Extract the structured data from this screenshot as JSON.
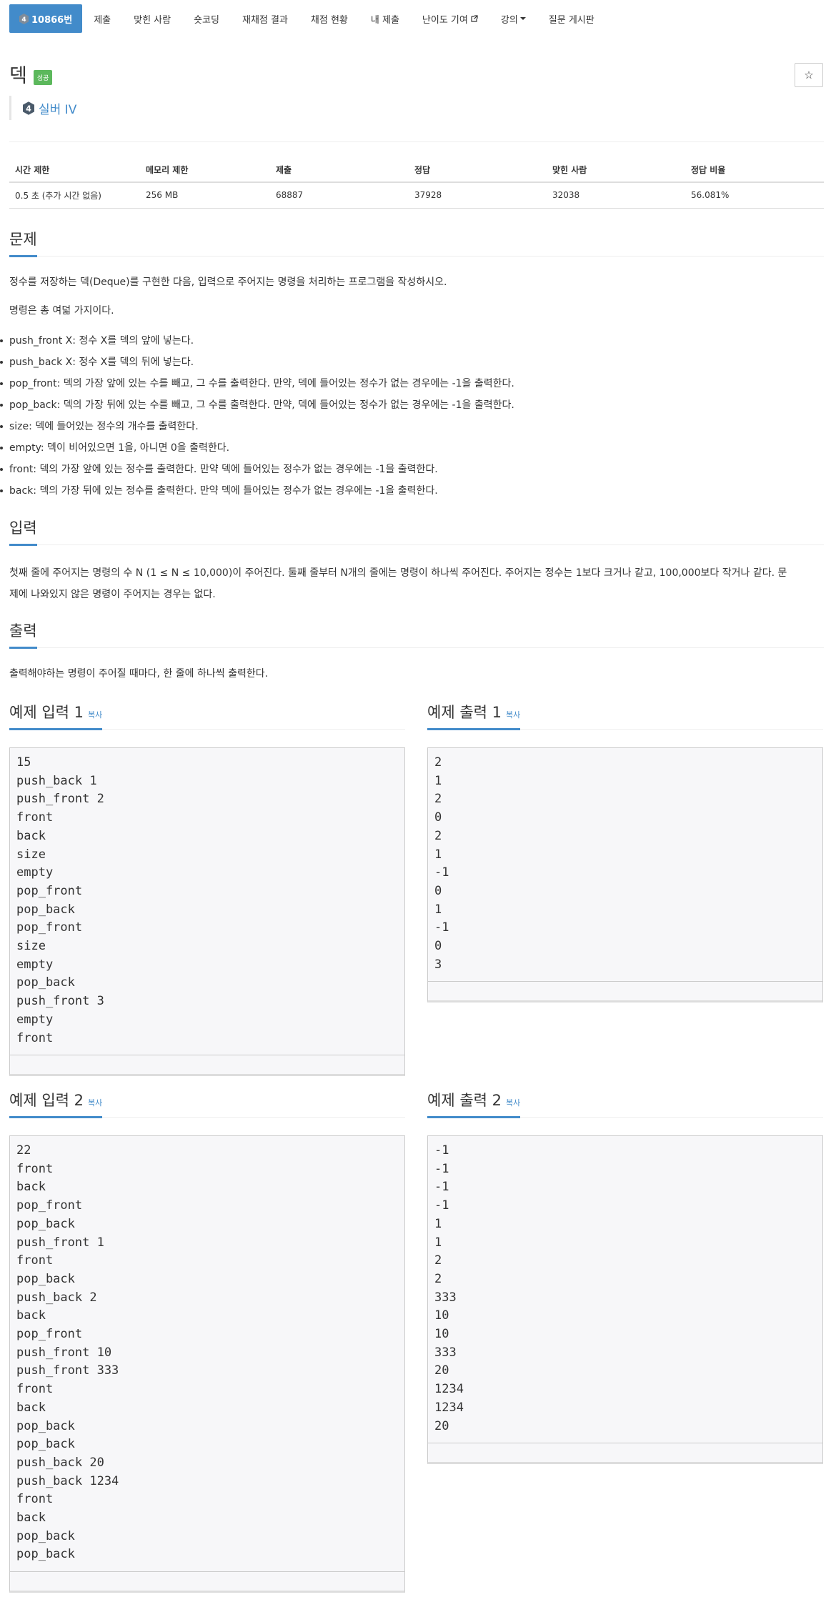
{
  "nav": {
    "problem_id": "10866번",
    "tier_digit": "4",
    "items": [
      "제출",
      "맞힌 사람",
      "숏코딩",
      "재채점 결과",
      "채점 현황",
      "내 제출",
      "난이도 기여",
      "강의",
      "질문 게시판"
    ]
  },
  "problem": {
    "title": "덱",
    "result": "성공",
    "star": "☆",
    "tier_digit": "4",
    "tier": "실버 IV"
  },
  "info": {
    "headers": [
      "시간 제한",
      "메모리 제한",
      "제출",
      "정답",
      "맞힌 사람",
      "정답 비율"
    ],
    "values": [
      "0.5 초 (추가 시간 없음)",
      "256 MB",
      "68887",
      "37928",
      "32038",
      "56.081%"
    ]
  },
  "sections": {
    "description_title": "문제",
    "description_p1": "정수를 저장하는 덱(Deque)를 구현한 다음, 입력으로 주어지는 명령을 처리하는 프로그램을 작성하시오.",
    "description_p2": "명령은 총 여덟 가지이다.",
    "commands": [
      "push_front X: 정수 X를 덱의 앞에 넣는다.",
      "push_back X: 정수 X를 덱의 뒤에 넣는다.",
      "pop_front: 덱의 가장 앞에 있는 수를 빼고, 그 수를 출력한다. 만약, 덱에 들어있는 정수가 없는 경우에는 -1을 출력한다.",
      "pop_back: 덱의 가장 뒤에 있는 수를 빼고, 그 수를 출력한다. 만약, 덱에 들어있는 정수가 없는 경우에는 -1을 출력한다.",
      "size: 덱에 들어있는 정수의 개수를 출력한다.",
      "empty: 덱이 비어있으면 1을, 아니면 0을 출력한다.",
      "front: 덱의 가장 앞에 있는 정수를 출력한다. 만약 덱에 들어있는 정수가 없는 경우에는 -1을 출력한다.",
      "back: 덱의 가장 뒤에 있는 정수를 출력한다. 만약 덱에 들어있는 정수가 없는 경우에는 -1을 출력한다."
    ],
    "input_title": "입력",
    "input_p1": "첫째 줄에 주어지는 명령의 수 N (1 ≤ N ≤ 10,000)이 주어진다. 둘째 줄부터 N개의 줄에는 명령이 하나씩 주어진다. 주어지는 정수는 1보다 크거나 같고, 100,000보다 작거나 같다. 문",
    "input_p2": "제에 나와있지 않은 명령이 주어지는 경우는 없다.",
    "output_title": "출력",
    "output_p": "출력해야하는 명령이 주어질 때마다, 한 줄에 하나씩 출력한다."
  },
  "samples": {
    "copy_label": "복사",
    "in1_title": "예제 입력 1",
    "out1_title": "예제 출력 1",
    "in2_title": "예제 입력 2",
    "out2_title": "예제 출력 2",
    "in1": "15\npush_back 1\npush_front 2\nfront\nback\nsize\nempty\npop_front\npop_back\npop_front\nsize\nempty\npop_back\npush_front 3\nempty\nfront",
    "out1": "2\n1\n2\n0\n2\n1\n-1\n0\n1\n-1\n0\n3",
    "in2": "22\nfront\nback\npop_front\npop_back\npush_front 1\nfront\npop_back\npush_back 2\nback\npop_front\npush_front 10\npush_front 333\nfront\nback\npop_back\npop_back\npush_back 20\npush_back 1234\nfront\nback\npop_back\npop_back",
    "out2": "-1\n-1\n-1\n-1\n1\n1\n2\n2\n333\n10\n10\n333\n20\n1234\n1234\n20"
  }
}
